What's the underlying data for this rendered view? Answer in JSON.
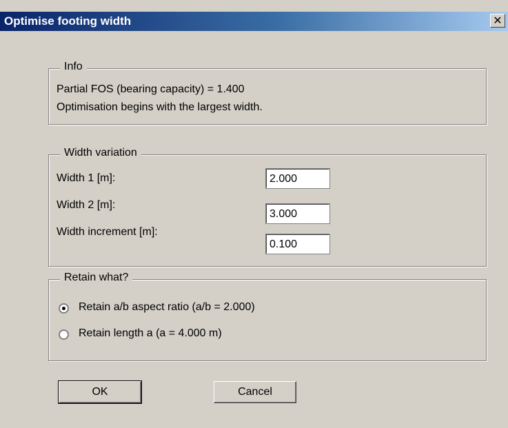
{
  "window": {
    "title": "Optimise footing width",
    "close_glyph": "✕"
  },
  "info": {
    "legend": "Info",
    "line1": "Partial FOS (bearing capacity) = 1.400",
    "line2": "Optimisation begins with the largest width."
  },
  "width_variation": {
    "legend": "Width variation",
    "width1_label": "Width 1 [m]:",
    "width1_value": "2.000",
    "width2_label": "Width 2 [m]:",
    "width2_value": "3.000",
    "increment_label": "Width increment [m]:",
    "increment_value": "0.100"
  },
  "retain": {
    "legend": "Retain what?",
    "option1": "Retain a/b aspect ratio (a/b = 2.000)",
    "option2": "Retain length a (a = 4.000 m)",
    "selected": "option1"
  },
  "buttons": {
    "ok": "OK",
    "cancel": "Cancel"
  }
}
